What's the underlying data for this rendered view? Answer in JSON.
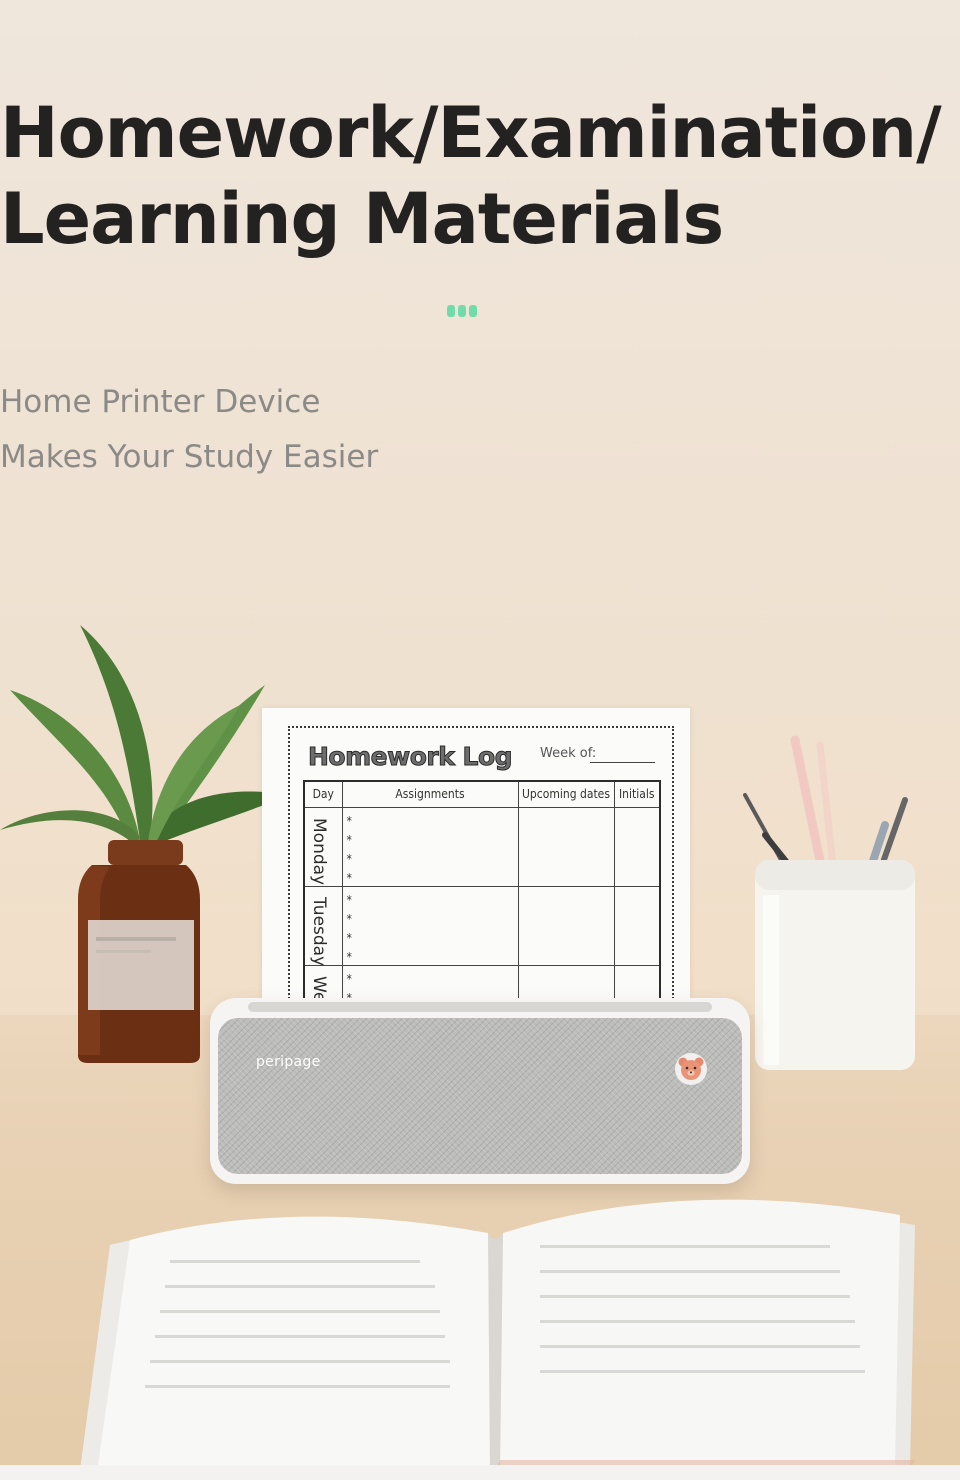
{
  "hero": {
    "title_line1": "Homework/Examination/",
    "title_line2": "Learning Materials",
    "subtitle_line1": "Home Printer Device",
    "subtitle_line2": "Makes Your Study Easier",
    "accent_color": "#71dcab"
  },
  "printout": {
    "title": "Homework Log",
    "week_label": "Week of:",
    "columns": [
      "Day",
      "Assignments",
      "Upcoming dates",
      "Initials"
    ],
    "days": [
      "Monday",
      "Tuesday",
      "Wednes"
    ],
    "bullet": "*"
  },
  "printer": {
    "brand": "peripage",
    "button_icon": "bear-icon"
  }
}
